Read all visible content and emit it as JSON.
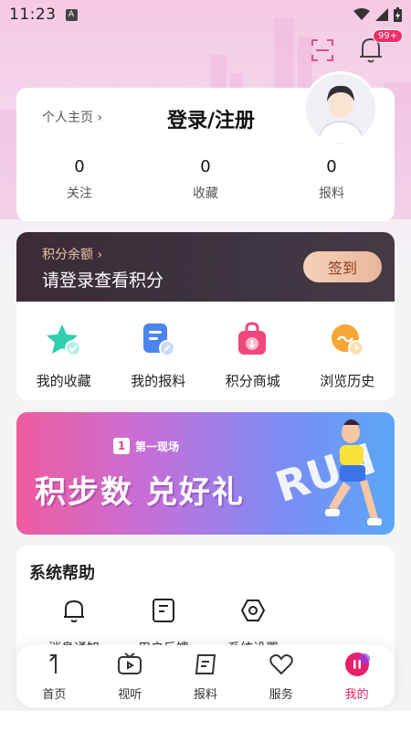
{
  "status_bar": {
    "time": "11:23",
    "indicator": "A"
  },
  "header": {
    "notification_count": "99+"
  },
  "profile": {
    "link": "个人主页",
    "title": "登录/注册",
    "stats": [
      {
        "value": "0",
        "label": "关注"
      },
      {
        "value": "0",
        "label": "收藏"
      },
      {
        "value": "0",
        "label": "报料"
      }
    ]
  },
  "points": {
    "subtitle": "积分余额",
    "main": "请登录查看积分",
    "checkin_label": "签到"
  },
  "quick_links": [
    {
      "label": "我的收藏",
      "icon": "star-icon"
    },
    {
      "label": "我的报料",
      "icon": "document-icon"
    },
    {
      "label": "积分商城",
      "icon": "shopping-bag-icon"
    },
    {
      "label": "浏览历史",
      "icon": "clock-icon"
    }
  ],
  "banner": {
    "logo_text": "第一现场",
    "logo_mark": "1",
    "title": "积步数 兑好礼",
    "decor_text": "RUN"
  },
  "help": {
    "title": "系统帮助",
    "items": [
      {
        "label": "消息通知",
        "icon": "bell-icon"
      },
      {
        "label": "用户反馈",
        "icon": "feedback-icon"
      },
      {
        "label": "系统设置",
        "icon": "settings-icon"
      }
    ]
  },
  "tabbar": {
    "items": [
      {
        "label": "首页",
        "icon": "home-icon"
      },
      {
        "label": "视听",
        "icon": "tv-icon"
      },
      {
        "label": "报料",
        "icon": "report-icon"
      },
      {
        "label": "服务",
        "icon": "heart-icon"
      },
      {
        "label": "我的",
        "icon": "profile-icon",
        "active": true
      }
    ]
  },
  "colors": {
    "accent": "#e7206b",
    "gold": "#e8c7a6",
    "points_bg": "#3b2b35"
  }
}
